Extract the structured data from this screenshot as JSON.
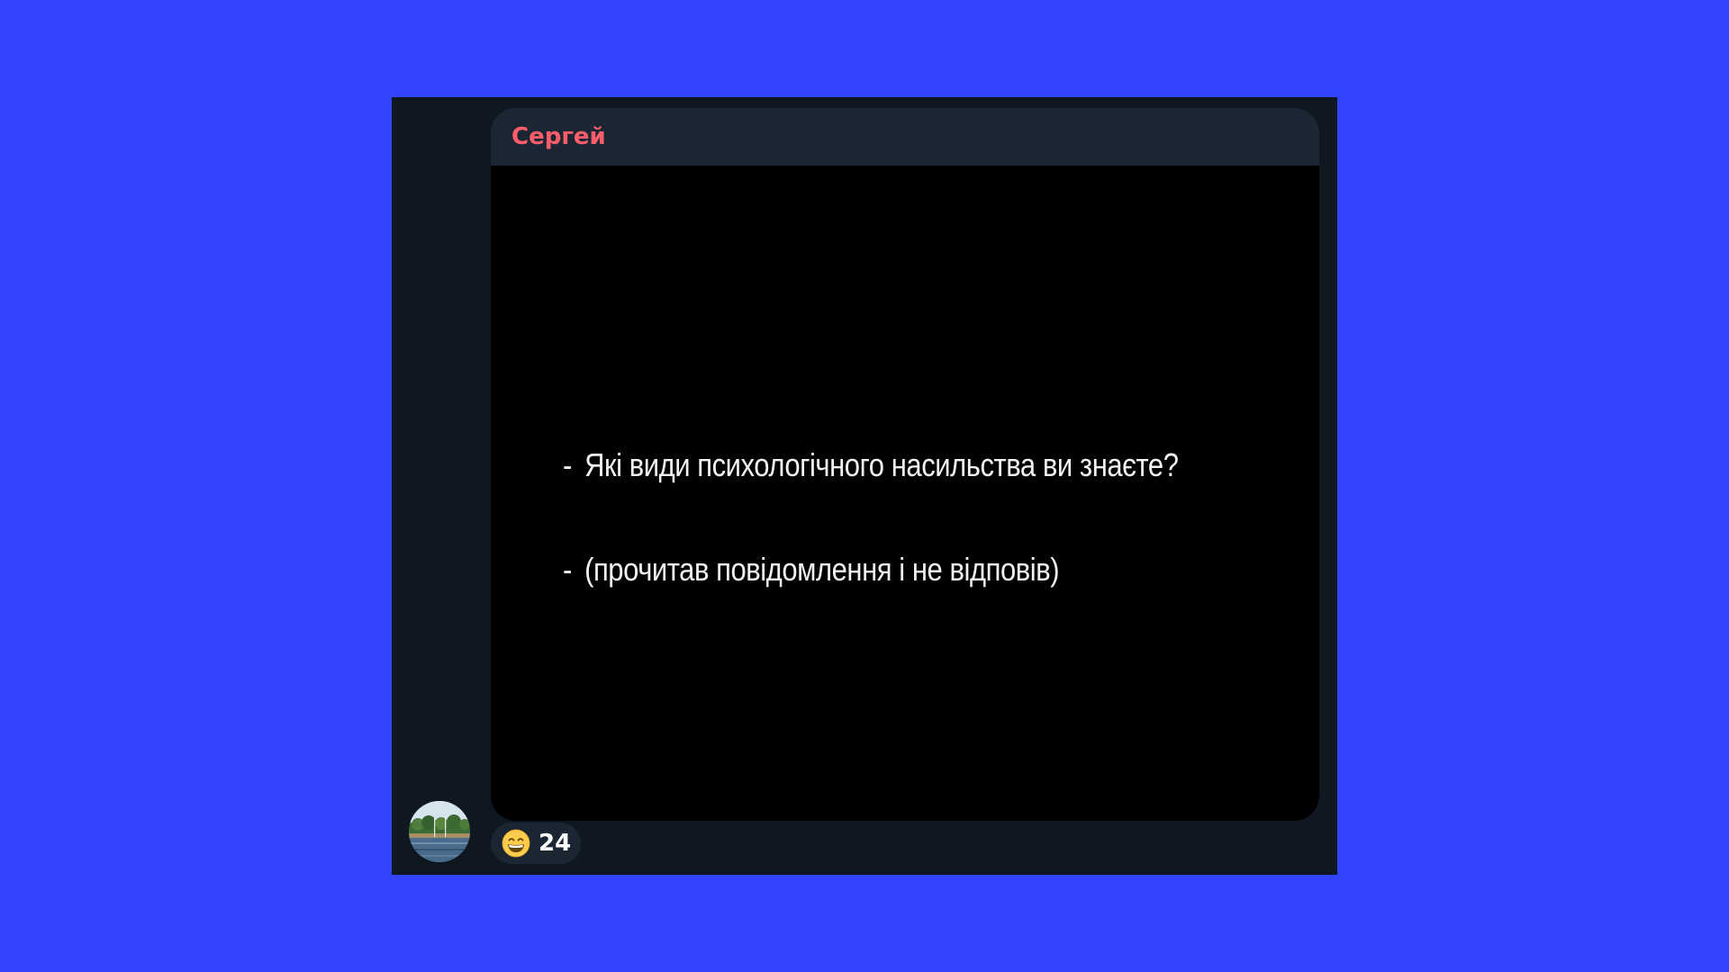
{
  "message": {
    "sender_name": "Сергей",
    "sender_color": "#ff5d6b",
    "image_text": {
      "line1_dash": "-",
      "line1": "Які види психологічного насильства ви знаєте?",
      "line2_dash": "-",
      "line2": "(прочитав повідомлення і не відповів)"
    }
  },
  "reaction": {
    "emoji_icon": "grinning-face-with-smiling-eyes-icon",
    "count": "24"
  },
  "colors": {
    "page_background": "#3344ff",
    "chat_background": "#0f1720",
    "bubble_background": "#1a2733"
  }
}
